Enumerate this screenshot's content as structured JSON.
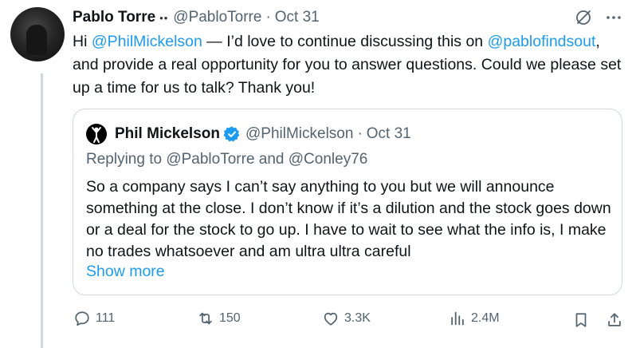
{
  "tweet": {
    "author_name": "Pablo Torre",
    "author_emoji": "••",
    "handle": "@PabloTorre",
    "separator": "·",
    "date": "Oct 31",
    "text": {
      "part1": "Hi ",
      "mention1": "@PhilMickelson",
      "part2": " — I’d love to continue discussing this on ",
      "mention2": "@pablofindsout",
      "part3": ", and provide a real opportunity for you to answer questions. Could we please set up a time for us to talk? Thank you!"
    }
  },
  "quote": {
    "author_name": "Phil Mickelson",
    "handle": "@PhilMickelson",
    "separator": "·",
    "date": "Oct 31",
    "replying_to": "Replying to @PabloTorre and @Conley76",
    "text": "So a company says I can’t say anything to you but we will announce something at the close. I don’t know if it’s a dilution and the stock goes down or a deal for the stock to go up. I have to wait to see what the info is, I make no trades whatsoever and am ultra ultra careful",
    "show_more": "Show more"
  },
  "actions": {
    "replies": "111",
    "reposts": "150",
    "likes": "3.3K",
    "views": "2.4M"
  },
  "colors": {
    "link": "#1d9bf0",
    "muted": "#536471",
    "text": "#0f1419",
    "border": "#cfd9de"
  },
  "icons": [
    "grok-icon",
    "more-icon",
    "verified-badge-icon",
    "reply-icon",
    "repost-icon",
    "like-icon",
    "views-icon",
    "bookmark-icon",
    "share-icon"
  ]
}
